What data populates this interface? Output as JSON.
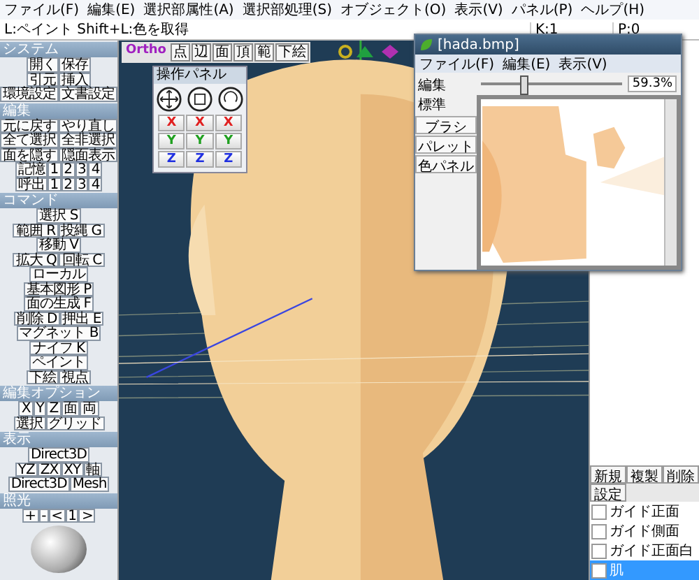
{
  "menu": [
    "ファイル(F)",
    "編集(E)",
    "選択部属性(A)",
    "選択部処理(S)",
    "オブジェクト(O)",
    "表示(V)",
    "パネル(P)",
    "ヘルプ(H)"
  ],
  "status": {
    "hint": "L:ペイント Shift+L:色を取得",
    "fields": [
      "K:1",
      "P:0"
    ]
  },
  "left_panel": [
    {
      "title": "システム",
      "groups": [
        {
          "buttons": [
            "開く",
            "保存"
          ]
        },
        {
          "buttons": [
            "引元",
            "挿入"
          ]
        },
        {
          "buttons": [
            "環境設定",
            "文書設定"
          ]
        }
      ]
    },
    {
      "title": "編集",
      "groups": [
        {
          "buttons": [
            "元に戻す",
            "やり直し"
          ]
        },
        {
          "buttons": [
            "全て選択",
            "全非選択"
          ]
        },
        {
          "buttons": [
            "面を隠す",
            "隠面表示"
          ]
        },
        {
          "buttons": [
            "記憶",
            "1",
            "2",
            "3",
            "4"
          ]
        },
        {
          "buttons": [
            "呼出",
            "1",
            "2",
            "3",
            "4"
          ]
        }
      ]
    },
    {
      "title": "コマンド",
      "groups": [
        {
          "buttons": [
            "選択 S"
          ]
        },
        {
          "buttons": [
            "範囲 R",
            "投縄 G"
          ]
        },
        {
          "buttons": [
            "移動 V"
          ]
        },
        {
          "buttons": [
            "拡大 Q",
            "回転 C"
          ]
        },
        {
          "buttons": [
            "ローカル"
          ]
        },
        {
          "buttons": [
            "基本図形 P"
          ]
        },
        {
          "buttons": [
            "面の生成 F"
          ]
        },
        {
          "buttons": [
            "削除 D",
            "押出 E"
          ]
        },
        {
          "buttons": [
            "マグネット B"
          ]
        },
        {
          "buttons": [
            "ナイフ K"
          ]
        },
        {
          "buttons": [
            "ペイント"
          ]
        },
        {
          "buttons": [
            "下絵",
            "視点"
          ]
        }
      ]
    },
    {
      "title": "編集オプション",
      "groups": [
        {
          "buttons": [
            "X",
            "Y",
            "Z",
            "面",
            "両"
          ]
        },
        {
          "buttons": [
            "選択",
            "グリッド"
          ]
        }
      ]
    },
    {
      "title": "表示",
      "groups": [
        {
          "buttons": [
            "Direct3D"
          ]
        },
        {
          "buttons": [
            "YZ",
            "ZX",
            "XY",
            "軸"
          ]
        },
        {
          "buttons": [
            "Direct3D",
            "Mesh"
          ]
        }
      ]
    }
  ],
  "light": {
    "title": "照光",
    "controls": [
      "+",
      "-",
      "<",
      "1",
      ">"
    ]
  },
  "viewport": {
    "mode": "Ortho",
    "tools": [
      "点",
      "辺",
      "面",
      "頂",
      "範",
      "下絵"
    ]
  },
  "op_panel": {
    "title": "操作パネル",
    "axes": [
      {
        "label": "X",
        "color": "#e02020"
      },
      {
        "label": "X",
        "color": "#e02020"
      },
      {
        "label": "X",
        "color": "#e02020"
      },
      {
        "label": "Y",
        "color": "#20a020"
      },
      {
        "label": "Y",
        "color": "#20a020"
      },
      {
        "label": "Y",
        "color": "#20a020"
      },
      {
        "label": "Z",
        "color": "#2030e0"
      },
      {
        "label": "Z",
        "color": "#2030e0"
      },
      {
        "label": "Z",
        "color": "#2030e0"
      }
    ]
  },
  "texture_window": {
    "title": "[hada.bmp]",
    "menu": [
      "ファイル(F)",
      "編集(E)",
      "表示(V)"
    ],
    "modes": [
      "編集",
      "標準"
    ],
    "tools": [
      "ブラシ",
      "パレット",
      "色パネル"
    ],
    "zoom": {
      "level": 0.3,
      "reading": "59.3%"
    }
  },
  "right_panel": {
    "buttons": [
      "新規",
      "複製",
      "削除",
      "設定"
    ],
    "materials": [
      {
        "name": "ガイド正面",
        "selected": false
      },
      {
        "name": "ガイド側面",
        "selected": false
      },
      {
        "name": "ガイド正面白",
        "selected": false
      },
      {
        "name": "肌",
        "selected": true
      }
    ]
  }
}
